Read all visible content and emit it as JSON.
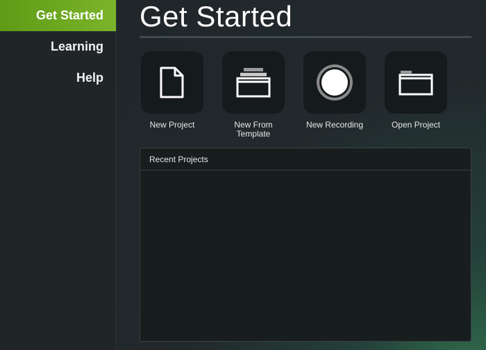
{
  "sidebar": {
    "items": [
      {
        "label": "Get Started",
        "active": true
      },
      {
        "label": "Learning",
        "active": false
      },
      {
        "label": "Help",
        "active": false
      }
    ]
  },
  "main": {
    "title": "Get Started",
    "actions": [
      {
        "label": "New Project",
        "icon": "document-icon"
      },
      {
        "label": "New From Template",
        "icon": "template-icon"
      },
      {
        "label": "New Recording",
        "icon": "record-icon"
      },
      {
        "label": "Open Project",
        "icon": "folder-icon"
      }
    ],
    "recent_projects": {
      "title": "Recent Projects",
      "items": []
    }
  },
  "colors": {
    "accent": "#6fa823",
    "sidebar_bg": "#202528",
    "tile_bg": "#151a1c"
  }
}
